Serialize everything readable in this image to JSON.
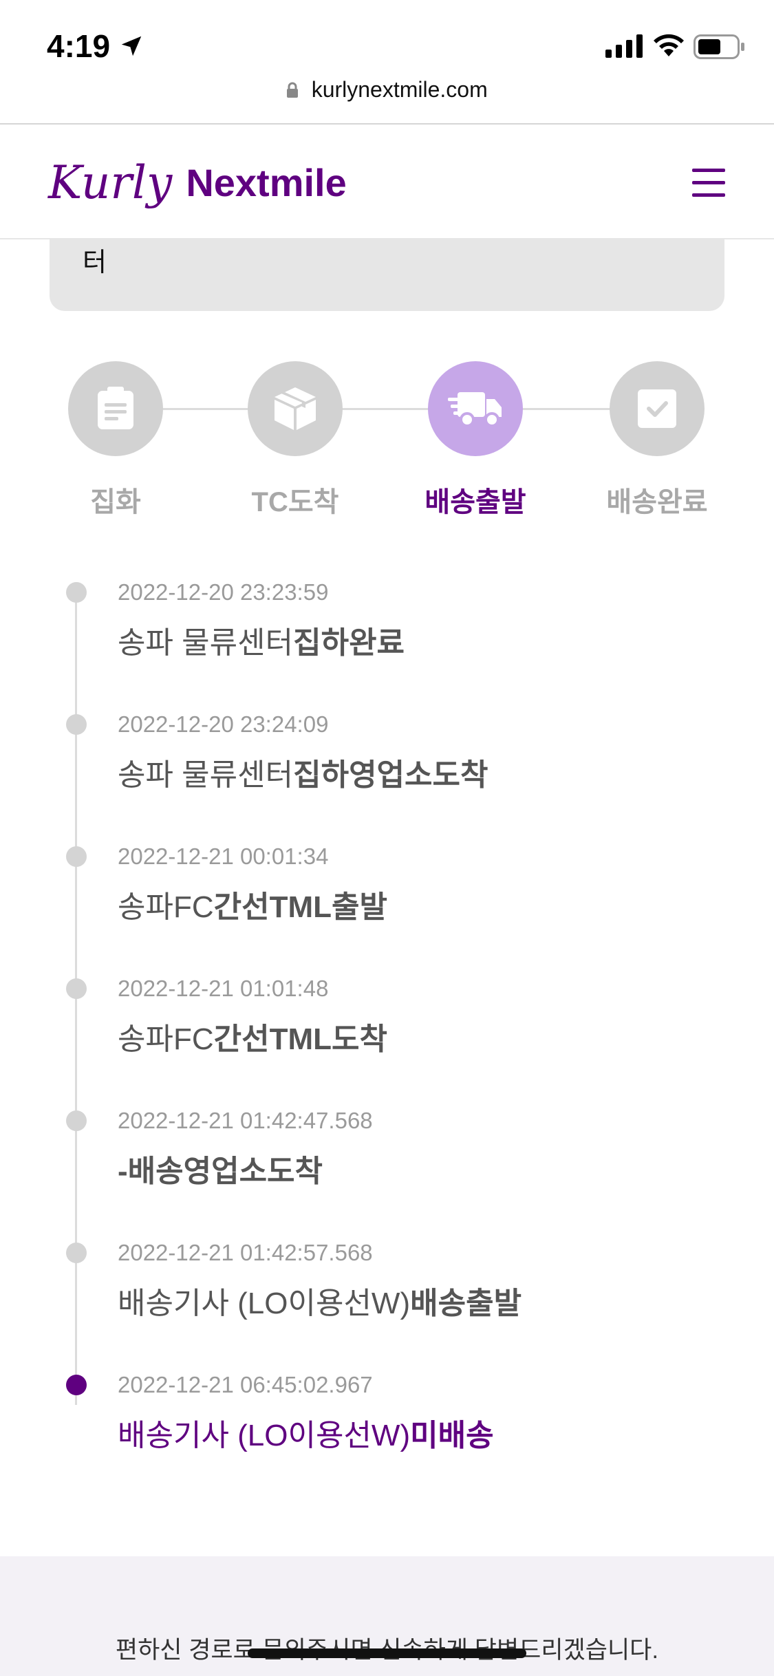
{
  "status_bar": {
    "time": "4:19",
    "icons": [
      "location-arrow-icon",
      "cellular-signal-icon",
      "wifi-icon",
      "battery-icon"
    ]
  },
  "browser": {
    "url": "kurlynextmile.com",
    "lock_icon": "lock-icon"
  },
  "header": {
    "logo_script": "Kurly",
    "logo_text": "Nextmile",
    "menu_icon": "hamburger-menu-icon",
    "brand_color": "#5f0080"
  },
  "address_card": {
    "text": "터"
  },
  "steps": [
    {
      "label": "집화",
      "icon": "clipboard-icon",
      "active": false
    },
    {
      "label": "TC도착",
      "icon": "box-icon",
      "active": false
    },
    {
      "label": "배송출발",
      "icon": "delivery-truck-icon",
      "active": true
    },
    {
      "label": "배송완료",
      "icon": "checkbox-icon",
      "active": false
    }
  ],
  "timeline": [
    {
      "time": "2022-12-20 23:23:59",
      "desc_normal": "송파 물류센터",
      "desc_bold": "집하완료",
      "active": false
    },
    {
      "time": "2022-12-20 23:24:09",
      "desc_normal": "송파 물류센터",
      "desc_bold": "집하영업소도착",
      "active": false
    },
    {
      "time": "2022-12-21 00:01:34",
      "desc_normal": "송파FC",
      "desc_bold": "간선TML출발",
      "active": false
    },
    {
      "time": "2022-12-21 01:01:48",
      "desc_normal": "송파FC",
      "desc_bold": "간선TML도착",
      "active": false
    },
    {
      "time": "2022-12-21 01:42:47.568",
      "desc_normal": "",
      "desc_bold": "-배송영업소도착",
      "active": false
    },
    {
      "time": "2022-12-21 01:42:57.568",
      "desc_normal": "배송기사 (LO이용선W)",
      "desc_bold": "배송출발",
      "active": false
    },
    {
      "time": "2022-12-21 06:45:02.967",
      "desc_normal": "배송기사 (LO이용선W)",
      "desc_bold": "미배송",
      "active": true
    }
  ],
  "footer": {
    "text": "편하신 경로로 문의주시면 신속하게 답변드리겠습니다."
  }
}
